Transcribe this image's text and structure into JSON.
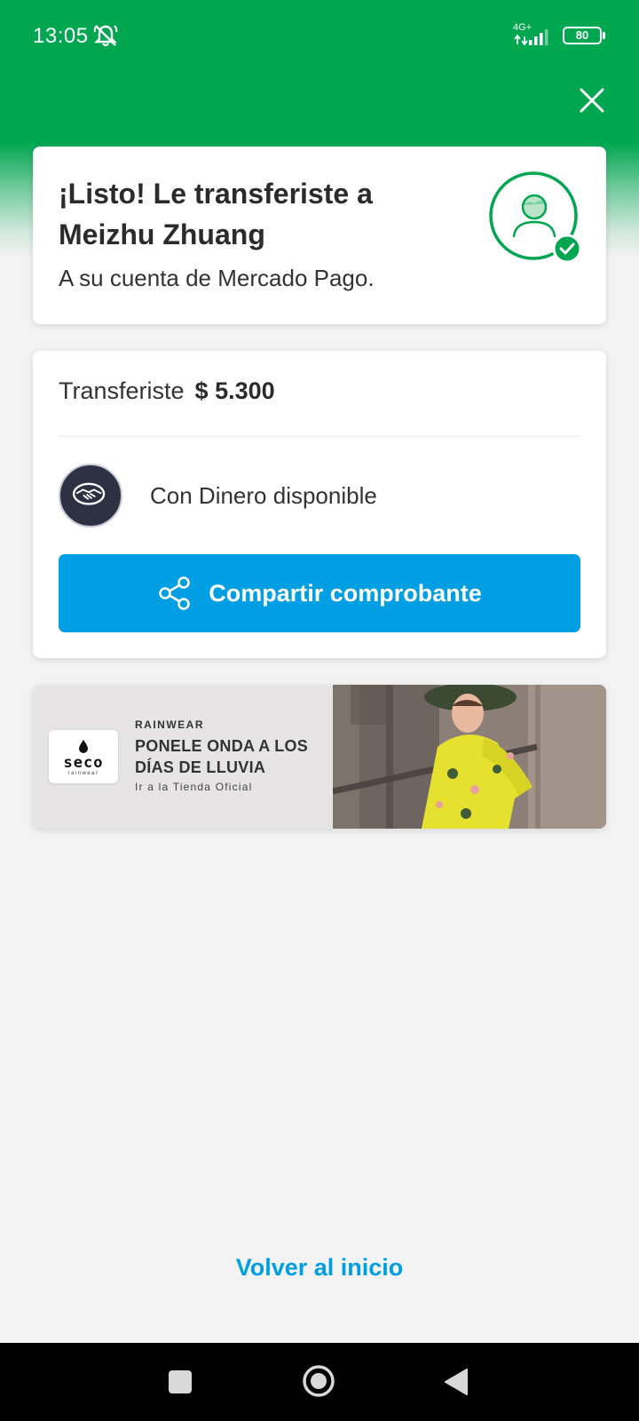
{
  "status_bar": {
    "time": "13:05",
    "network": "4G+",
    "battery": "80",
    "icons": [
      "mute-bell-icon",
      "signal-icon",
      "battery-icon"
    ]
  },
  "header": {
    "close_icon": "close-icon",
    "accent_color": "#00a650"
  },
  "confirmation": {
    "title": "¡Listo! Le transferiste a Meizhu Zhuang",
    "subtitle": "A su cuenta de Mercado Pago.",
    "avatar_icon": "user-check-icon"
  },
  "transfer": {
    "label": "Transferiste",
    "amount": "$ 5.300",
    "method_icon": "handshake-icon",
    "method": "Con Dinero disponible",
    "share_button": "Compartir comprobante",
    "share_icon": "share-icon",
    "button_color": "#009ee3"
  },
  "banner": {
    "brand": "seco",
    "brand_sub": "rainwear",
    "eyebrow": "RAINWEAR",
    "title": "PONELE ONDA A LOS DÍAS DE LLUVIA",
    "cta": "Ir a la Tienda Oficial"
  },
  "footer": {
    "back_link": "Volver al inicio"
  },
  "nav_bar": {
    "icons": [
      "recent-apps-icon",
      "home-icon",
      "back-icon"
    ]
  }
}
